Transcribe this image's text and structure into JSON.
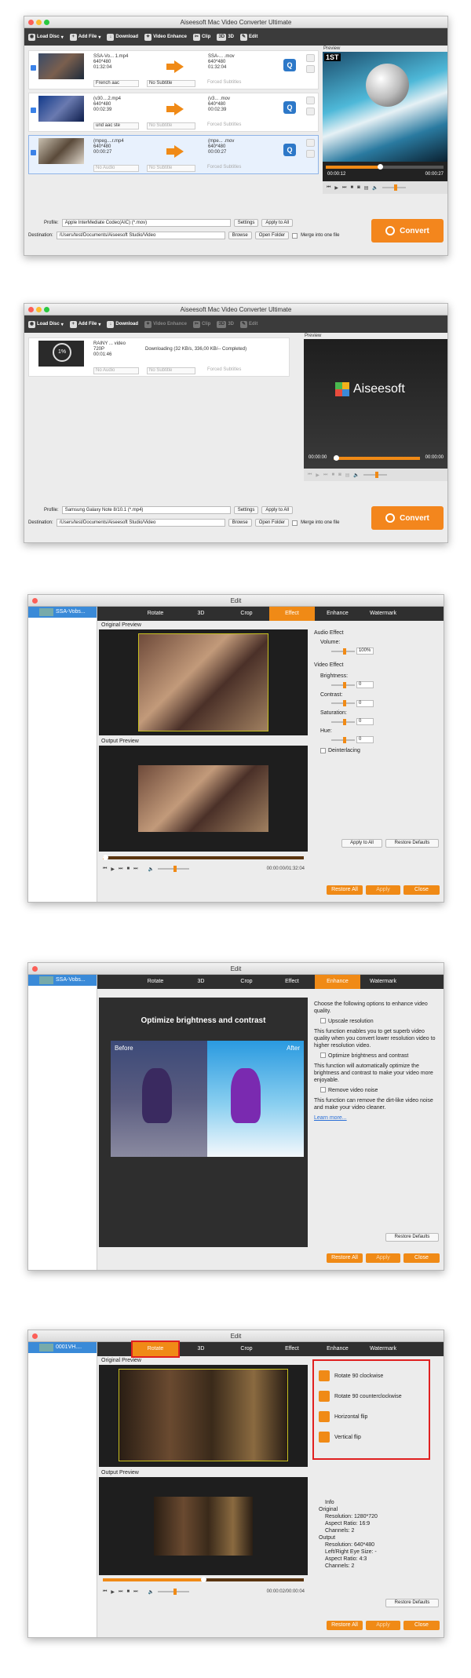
{
  "app_title": "Aiseesoft Mac Video Converter Ultimate",
  "toolbar1": {
    "load_disc": "Load Disc",
    "add_file": "Add File",
    "download": "Download",
    "video_enhance": "Video Enhance",
    "clip": "Clip",
    "three_d_icon": "3D",
    "three_d": "3D",
    "edit": "Edit"
  },
  "files": [
    {
      "src_name": "SSA-Vo... 1.mp4",
      "src_res": "640*480",
      "src_dur": "01:32:04",
      "dst_name": "SSA-... .mov",
      "dst_res": "640*480",
      "dst_dur": "01:32:04",
      "audio": "French aac",
      "subtitle": "No Subtitle",
      "forced": "Forced Subtitles"
    },
    {
      "src_name": "(v30....2.mp4",
      "src_res": "640*480",
      "src_dur": "00:02:39",
      "dst_name": "(v3... .mov",
      "dst_res": "640*480",
      "dst_dur": "00:02:39",
      "audio": "und aac ste",
      "subtitle": "No Subtitle",
      "forced": "Forced Subtitles"
    },
    {
      "src_name": "(mpeg....r.mp4",
      "src_res": "640*480",
      "src_dur": "00:00:27",
      "dst_name": "(mpe... .mov",
      "dst_res": "640*480",
      "dst_dur": "00:00:27",
      "audio": "No Audio",
      "subtitle": "No Subtitle",
      "forced": "Forced Subtitles"
    }
  ],
  "preview_label": "Preview",
  "preview1": {
    "time_left": "00:00:12",
    "time_right": "00:00:27",
    "logo": "1ST"
  },
  "win1_bottom": {
    "profile_label": "Profile:",
    "profile": "Apple InterMediate Codec(AIC) (*.mov)",
    "settings": "Settings",
    "apply_all": "Apply to All",
    "dest_label": "Destination:",
    "dest": "/Users/test/Documents/Aiseesoft Studio/Video",
    "browse": "Browse",
    "open_folder": "Open Folder",
    "merge": "Merge into one file",
    "convert": "Convert"
  },
  "win2": {
    "name": "RAINY ... video",
    "res": "720P",
    "dur": "00:01:46",
    "progress_pct": "1%",
    "status": "Downloading (32 KB/s, 336,00 KB/-- Completed)",
    "audio": "No Audio",
    "subtitle": "No Subtitle",
    "forced": "Forced Subtitles",
    "brand": "Aiseesoft",
    "time_left": "00:00:00",
    "time_right": "00:00:00",
    "profile_label": "Profile:",
    "profile": "Samsung Galaxy Note 8/10.1 (*.mp4)",
    "settings": "Settings",
    "apply_all": "Apply to All",
    "dest_label": "Destination:",
    "dest": "/Users/test/Documents/Aiseesoft Studio/Video",
    "browse": "Browse",
    "open_folder": "Open Folder",
    "merge": "Merge into one file",
    "convert": "Convert"
  },
  "edit_title": "Edit",
  "edit_tabs": [
    "Rotate",
    "3D",
    "Crop",
    "Effect",
    "Enhance",
    "Watermark"
  ],
  "effect": {
    "list_item": "SSA-Vobs...",
    "original_preview": "Original Preview",
    "output_preview": "Output Preview",
    "audio_effect": "Audio Effect",
    "volume": "Volume:",
    "volume_val": "100%",
    "video_effect": "Video Effect",
    "brightness": "Brightness:",
    "contrast": "Contrast:",
    "saturation": "Saturation:",
    "hue": "Hue:",
    "brightness_val": "0",
    "contrast_val": "0",
    "saturation_val": "0",
    "hue_val": "0",
    "deinterlacing": "Deinterlacing",
    "time": "00:00:00/01:32:04",
    "apply_all": "Apply to All",
    "restore_defaults": "Restore Defaults",
    "restore_all": "Restore All",
    "apply": "Apply",
    "close": "Close"
  },
  "enhance": {
    "list_item": "SSA-Vobs...",
    "heading": "Optimize brightness and contrast",
    "before": "Before",
    "after": "After",
    "intro": "Choose the following options to enhance video quality.",
    "opt1": "Upscale resolution",
    "desc1": "This function enables you to get superb video quality when you convert lower resolution video to higher resolution video.",
    "opt2": "Optimize brightness and contrast",
    "desc2": "This function will automatically optimize the brightness and contrast to make your video more enjoyable.",
    "opt3": "Remove video noise",
    "desc3": "This function can remove the dirt-like video noise and make your video cleaner.",
    "learn_more": "Learn more...",
    "restore_defaults": "Restore Defaults",
    "restore_all": "Restore All",
    "apply": "Apply",
    "close": "Close"
  },
  "rotate": {
    "list_item": "0001VH....",
    "original_preview": "Original Preview",
    "output_preview": "Output Preview",
    "rot_cw": "Rotate 90 clockwise",
    "rot_ccw": "Rotate 90 counterclockwise",
    "hflip": "Horizontal flip",
    "vflip": "Vertical flip",
    "info": "Info",
    "original": "Original",
    "o_res": "Resolution: 1280*720",
    "o_ar": "Aspect Ratio: 16:9",
    "o_ch": "Channels: 2",
    "output": "Output",
    "p_res": "Resolution: 640*480",
    "p_eye": "Left/Right Eye Size: -",
    "p_ar": "Aspect Ratio: 4:3",
    "p_ch": "Channels: 2",
    "time": "00:00:02/00:00:04",
    "restore_defaults": "Restore Defaults",
    "restore_all": "Restore All",
    "apply": "Apply",
    "close": "Close"
  },
  "colors": {
    "accent": "#f08a16",
    "toolbar": "#3b3b3b",
    "select_blue": "#3a8ad8",
    "highlight_red": "#e02020"
  }
}
